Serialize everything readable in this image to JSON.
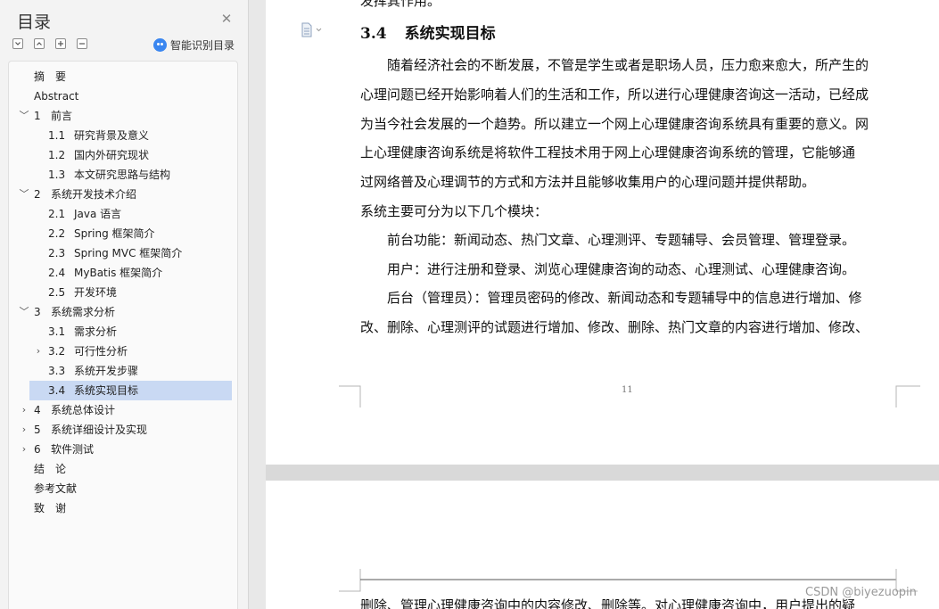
{
  "nav": {
    "title": "目录",
    "close_glyph": "✕",
    "toolbar": [
      "expand-all",
      "collapse-up",
      "add",
      "remove"
    ],
    "smart_toc_label": "智能识别目录",
    "items": [
      {
        "num": "",
        "label": "摘　要",
        "level": 1,
        "expander": ""
      },
      {
        "num": "",
        "label": "Abstract",
        "level": 1,
        "expander": ""
      },
      {
        "num": "1",
        "label": "前言",
        "level": 1,
        "expander": "﹀"
      },
      {
        "num": "1.1",
        "label": "研究背景及意义",
        "level": 2,
        "expander": ""
      },
      {
        "num": "1.2",
        "label": "国内外研究现状",
        "level": 2,
        "expander": ""
      },
      {
        "num": "1.3",
        "label": "本文研究思路与结构",
        "level": 2,
        "expander": ""
      },
      {
        "num": "2",
        "label": "系统开发技术介绍",
        "level": 1,
        "expander": "﹀"
      },
      {
        "num": "2.1",
        "label": "Java 语言",
        "level": 2,
        "expander": ""
      },
      {
        "num": "2.2",
        "label": "Spring 框架简介",
        "level": 2,
        "expander": ""
      },
      {
        "num": "2.3",
        "label": "Spring MVC 框架简介",
        "level": 2,
        "expander": ""
      },
      {
        "num": "2.4",
        "label": "MyBatis 框架简介",
        "level": 2,
        "expander": ""
      },
      {
        "num": "2.5",
        "label": "开发环境",
        "level": 2,
        "expander": ""
      },
      {
        "num": "3",
        "label": "系统需求分析",
        "level": 1,
        "expander": "﹀"
      },
      {
        "num": "3.1",
        "label": "需求分析",
        "level": 2,
        "expander": ""
      },
      {
        "num": "3.2",
        "label": "可行性分析",
        "level": 2,
        "expander": "›"
      },
      {
        "num": "3.3",
        "label": "系统开发步骤",
        "level": 2,
        "expander": ""
      },
      {
        "num": "3.4",
        "label": "系统实现目标",
        "level": 2,
        "expander": "",
        "selected": true
      },
      {
        "num": "4",
        "label": "系统总体设计",
        "level": 1,
        "expander": "›"
      },
      {
        "num": "5",
        "label": "系统详细设计及实现",
        "level": 1,
        "expander": "›"
      },
      {
        "num": "6",
        "label": "软件测试",
        "level": 1,
        "expander": "›"
      },
      {
        "num": "",
        "label": "结　论",
        "level": 1,
        "expander": ""
      },
      {
        "num": "",
        "label": "参考文献",
        "level": 1,
        "expander": ""
      },
      {
        "num": "",
        "label": "致　谢",
        "level": 1,
        "expander": ""
      }
    ]
  },
  "document": {
    "top_cut_text": "发挥其作用。",
    "heading_num": "3.4",
    "heading_text": "系统实现目标",
    "lines": [
      "　　随着经济社会的不断发展，不管是学生或者是职场人员，压力愈来愈大，所产生的",
      "心理问题已经开始影响着人们的生活和工作，所以进行心理健康咨询这一活动，已经成",
      "为当今社会发展的一个趋势。所以建立一个网上心理健康咨询系统具有重要的意义。网",
      "上心理健康咨询系统是将软件工程技术用于网上心理健康咨询系统的管理，它能够通",
      "过网络普及心理调节的方式和方法并且能够收集用户的心理问题并提供帮助。",
      "系统主要可分为以下几个模块：",
      "　　前台功能：新闻动态、热门文章、心理测评、专题辅导、会员管理、管理登录。",
      "　　用户：进行注册和登录、浏览心理健康咨询的动态、心理测试、心理健康咨询。",
      "　　后台（管理员）：管理员密码的修改、新闻动态和专题辅导中的信息进行增加、修",
      "改、删除、心理测评的试题进行增加、修改、删除、热门文章的内容进行增加、修改、"
    ],
    "page_number": "11",
    "page2_first_line": "删除、管理心理健康咨询中的内容修改、删除等。对心理健康咨询中，用户提出的疑"
  },
  "watermark": "CSDN @biyezuopin"
}
